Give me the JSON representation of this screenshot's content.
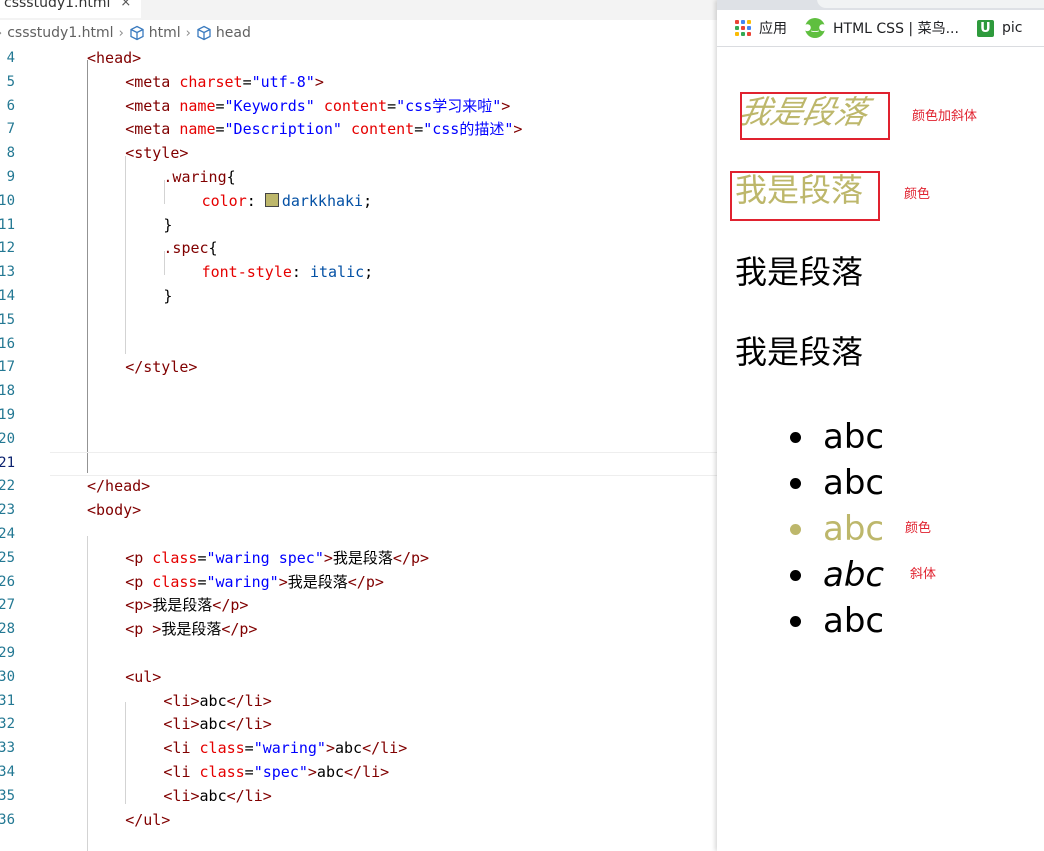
{
  "editor": {
    "tab": {
      "label": "cssstudy1.html",
      "close": "×"
    },
    "breadcrumb": [
      {
        "label": "cssstudy1.html",
        "icon": "none"
      },
      {
        "label": "html",
        "icon": "cube-icon"
      },
      {
        "label": "head",
        "icon": "cube-icon"
      }
    ],
    "current_line": 21,
    "lines": [
      {
        "n": "4",
        "tokens": [
          [
            "t-tag",
            "<head>"
          ]
        ]
      },
      {
        "n": "5",
        "tokens": [
          [
            "t-tag",
            "<meta "
          ],
          [
            "t-attr",
            "charset"
          ],
          [
            "t-txt",
            "="
          ],
          [
            "t-str",
            "\"utf-8\""
          ],
          [
            "t-tag",
            ">"
          ]
        ]
      },
      {
        "n": "6",
        "tokens": [
          [
            "t-tag",
            "<meta "
          ],
          [
            "t-attr",
            "name"
          ],
          [
            "t-txt",
            "="
          ],
          [
            "t-str",
            "\"Keywords\""
          ],
          [
            "t-txt",
            " "
          ],
          [
            "t-attr",
            "content"
          ],
          [
            "t-txt",
            "="
          ],
          [
            "t-str",
            "\"css学习来啦\""
          ],
          [
            "t-tag",
            ">"
          ]
        ]
      },
      {
        "n": "7",
        "tokens": [
          [
            "t-tag",
            "<meta "
          ],
          [
            "t-attr",
            "name"
          ],
          [
            "t-txt",
            "="
          ],
          [
            "t-str",
            "\"Description\""
          ],
          [
            "t-txt",
            " "
          ],
          [
            "t-attr",
            "content"
          ],
          [
            "t-txt",
            "="
          ],
          [
            "t-str",
            "\"css的描述\""
          ],
          [
            "t-tag",
            ">"
          ]
        ]
      },
      {
        "n": "8",
        "tokens": [
          [
            "t-tag",
            "<style>"
          ]
        ]
      },
      {
        "n": "9",
        "tokens": [
          [
            "t-sel",
            ".waring"
          ],
          [
            "t-txt",
            "{"
          ]
        ]
      },
      {
        "n": "10",
        "tokens": [
          [
            "t-prop",
            "color"
          ],
          [
            "t-txt",
            ": "
          ],
          [
            "swatch",
            "#bdb76b"
          ],
          [
            "t-val",
            "darkkhaki"
          ],
          [
            "t-txt",
            ";"
          ]
        ]
      },
      {
        "n": "11",
        "tokens": [
          [
            "t-txt",
            "}"
          ]
        ]
      },
      {
        "n": "12",
        "tokens": [
          [
            "t-sel",
            ".spec"
          ],
          [
            "t-txt",
            "{"
          ]
        ]
      },
      {
        "n": "13",
        "tokens": [
          [
            "t-prop",
            "font-style"
          ],
          [
            "t-txt",
            ": "
          ],
          [
            "t-val",
            "italic"
          ],
          [
            "t-txt",
            ";"
          ]
        ]
      },
      {
        "n": "14",
        "tokens": [
          [
            "t-txt",
            "}"
          ]
        ]
      },
      {
        "n": "15",
        "tokens": []
      },
      {
        "n": "16",
        "tokens": []
      },
      {
        "n": "17",
        "tokens": [
          [
            "t-tag",
            "</style>"
          ]
        ]
      },
      {
        "n": "18",
        "tokens": []
      },
      {
        "n": "19",
        "tokens": []
      },
      {
        "n": "20",
        "tokens": []
      },
      {
        "n": "21",
        "tokens": []
      },
      {
        "n": "22",
        "tokens": [
          [
            "t-tag",
            "</head>"
          ]
        ]
      },
      {
        "n": "23",
        "tokens": [
          [
            "t-tag",
            "<body>"
          ]
        ]
      },
      {
        "n": "24",
        "tokens": []
      },
      {
        "n": "25",
        "tokens": [
          [
            "t-tag",
            "<p "
          ],
          [
            "t-attr",
            "class"
          ],
          [
            "t-txt",
            "="
          ],
          [
            "t-str",
            "\"waring spec\""
          ],
          [
            "t-tag",
            ">"
          ],
          [
            "t-txt",
            "我是段落"
          ],
          [
            "t-tag",
            "</p>"
          ]
        ]
      },
      {
        "n": "26",
        "tokens": [
          [
            "t-tag",
            "<p "
          ],
          [
            "t-attr",
            "class"
          ],
          [
            "t-txt",
            "="
          ],
          [
            "t-str",
            "\"waring\""
          ],
          [
            "t-tag",
            ">"
          ],
          [
            "t-txt",
            "我是段落"
          ],
          [
            "t-tag",
            "</p>"
          ]
        ]
      },
      {
        "n": "27",
        "tokens": [
          [
            "t-tag",
            "<p>"
          ],
          [
            "t-txt",
            "我是段落"
          ],
          [
            "t-tag",
            "</p>"
          ]
        ]
      },
      {
        "n": "28",
        "tokens": [
          [
            "t-tag",
            "<p >"
          ],
          [
            "t-txt",
            "我是段落"
          ],
          [
            "t-tag",
            "</p>"
          ]
        ]
      },
      {
        "n": "29",
        "tokens": []
      },
      {
        "n": "30",
        "tokens": [
          [
            "t-tag",
            "<ul>"
          ]
        ]
      },
      {
        "n": "31",
        "tokens": [
          [
            "t-tag",
            "<li>"
          ],
          [
            "t-txt",
            "abc"
          ],
          [
            "t-tag",
            "</li>"
          ]
        ]
      },
      {
        "n": "32",
        "tokens": [
          [
            "t-tag",
            "<li>"
          ],
          [
            "t-txt",
            "abc"
          ],
          [
            "t-tag",
            "</li>"
          ]
        ]
      },
      {
        "n": "33",
        "tokens": [
          [
            "t-tag",
            "<li "
          ],
          [
            "t-attr",
            "class"
          ],
          [
            "t-txt",
            "="
          ],
          [
            "t-str",
            "\"waring\""
          ],
          [
            "t-tag",
            ">"
          ],
          [
            "t-txt",
            "abc"
          ],
          [
            "t-tag",
            "</li>"
          ]
        ]
      },
      {
        "n": "34",
        "tokens": [
          [
            "t-tag",
            "<li "
          ],
          [
            "t-attr",
            "class"
          ],
          [
            "t-txt",
            "="
          ],
          [
            "t-str",
            "\"spec\""
          ],
          [
            "t-tag",
            ">"
          ],
          [
            "t-txt",
            "abc"
          ],
          [
            "t-tag",
            "</li>"
          ]
        ]
      },
      {
        "n": "35",
        "tokens": [
          [
            "t-tag",
            "<li>"
          ],
          [
            "t-txt",
            "abc"
          ],
          [
            "t-tag",
            "</li>"
          ]
        ]
      },
      {
        "n": "36",
        "tokens": [
          [
            "t-tag",
            "</ul>"
          ]
        ]
      }
    ]
  },
  "browser": {
    "bookmarks": [
      {
        "label": "应用",
        "icon": "apps-grid-icon"
      },
      {
        "label": "HTML CSS | 菜鸟...",
        "icon": "runoob-icon"
      },
      {
        "label": "pic",
        "icon": "pic-icon"
      }
    ],
    "paragraphs": [
      {
        "text": "我是段落",
        "color": "#bdb76b",
        "italic": true,
        "annotation": "颜色加斜体"
      },
      {
        "text": "我是段落",
        "color": "#bdb76b",
        "italic": false,
        "annotation": "颜色"
      },
      {
        "text": "我是段落",
        "color": "#000000",
        "italic": false,
        "annotation": ""
      },
      {
        "text": "我是段落",
        "color": "#000000",
        "italic": false,
        "annotation": ""
      }
    ],
    "list_items": [
      {
        "text": "abc",
        "color": "#000000",
        "italic": false,
        "annotation": ""
      },
      {
        "text": "abc",
        "color": "#000000",
        "italic": false,
        "annotation": ""
      },
      {
        "text": "abc",
        "color": "#bdb76b",
        "italic": false,
        "annotation": "颜色"
      },
      {
        "text": "abc",
        "color": "#000000",
        "italic": true,
        "annotation": "斜体"
      },
      {
        "text": "abc",
        "color": "#000000",
        "italic": false,
        "annotation": ""
      }
    ],
    "annotation_color": "#e0222f"
  }
}
